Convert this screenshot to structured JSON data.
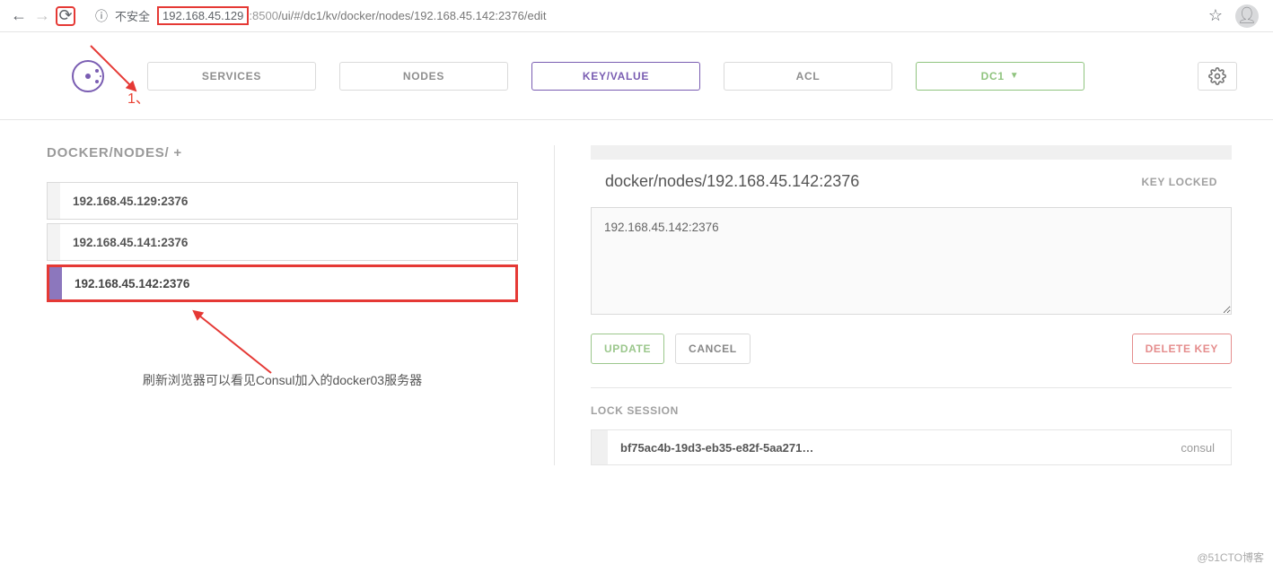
{
  "browser": {
    "insecure_label": "不安全",
    "url_ip": "192.168.45.129",
    "url_port": ":8500",
    "url_path": "/ui/#/dc1/kv/docker/nodes/192.168.45.142:2376/edit"
  },
  "annotations": {
    "one": "1、",
    "note": "刷新浏览器可以看见Consul加入的docker03服务器"
  },
  "nav": {
    "services": "SERVICES",
    "nodes": "NODES",
    "kv": "KEY/VALUE",
    "acl": "ACL",
    "dc": "DC1"
  },
  "breadcrumb": "DOCKER/NODES/ +",
  "kv_items": [
    {
      "label": "192.168.45.129:2376",
      "active": false
    },
    {
      "label": "192.168.45.141:2376",
      "active": false
    },
    {
      "label": "192.168.45.142:2376",
      "active": true
    }
  ],
  "detail": {
    "path": "docker/nodes/192.168.45.142:2376",
    "locked": "KEY LOCKED",
    "value": "192.168.45.142:2376",
    "update": "UPDATE",
    "cancel": "CANCEL",
    "delete": "DELETE KEY"
  },
  "session": {
    "header": "LOCK SESSION",
    "id": "bf75ac4b-19d3-eb35-e82f-5aa271…",
    "tag": "consul"
  },
  "watermark": "@51CTO博客"
}
